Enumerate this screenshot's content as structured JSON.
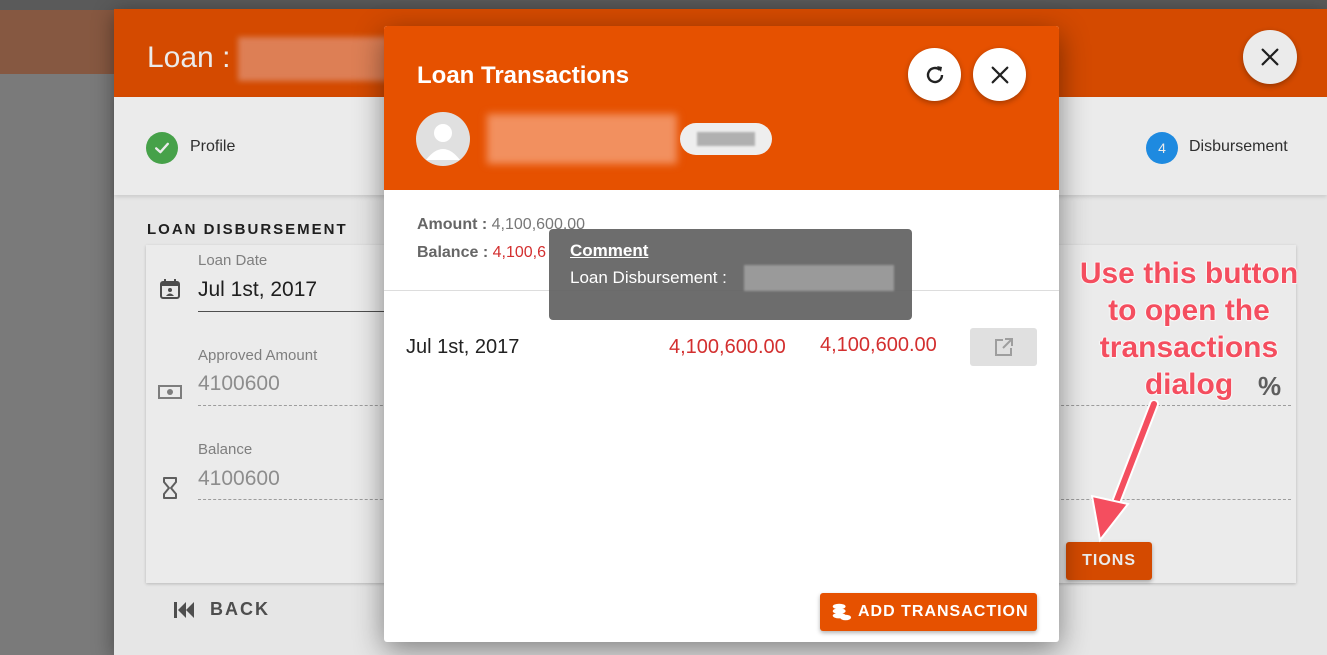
{
  "loan_dialog": {
    "title": "Loan :",
    "stepper": {
      "step1_label": "Profile",
      "step4_number": "4",
      "step4_label": "Disbursement"
    },
    "section_title": "LOAN DISBURSEMENT",
    "fields": {
      "loan_date_label": "Loan Date",
      "loan_date_value": "Jul 1st, 2017",
      "approved_label": "Approved Amount",
      "approved_value": "4100600",
      "balance_label": "Balance",
      "balance_value": "4100600"
    },
    "transactions_button_partial": "TIONS",
    "back_label": "BACK",
    "icons": [
      "calendar-icon",
      "money-icon",
      "hourglass-icon",
      "percent-icon",
      "close-icon",
      "check-icon",
      "skip-previous-icon"
    ]
  },
  "transactions_dialog": {
    "title": "Loan Transactions",
    "summary": {
      "amount_label": "Amount :",
      "amount_value": "4,100,600.00",
      "balance_label": "Balance :",
      "balance_value": "4,100,6"
    },
    "rows": [
      {
        "date": "Jul 1st, 2017",
        "amount": "4,100,600.00",
        "balance": "4,100,600.00"
      }
    ],
    "add_button": "ADD TRANSACTION",
    "icons": [
      "refresh-icon",
      "close-icon",
      "avatar-icon",
      "open-in-new-icon",
      "coins-icon"
    ]
  },
  "tooltip": {
    "title": "Comment",
    "text": "Loan Disbursement :"
  },
  "annotation": {
    "text": "Use this button to open the transactions dialog",
    "color": "#f44e5f"
  },
  "colors": {
    "primary": "#e65100",
    "success": "#4caf50",
    "step_active": "#2196f3",
    "amount": "#d32f2f"
  }
}
